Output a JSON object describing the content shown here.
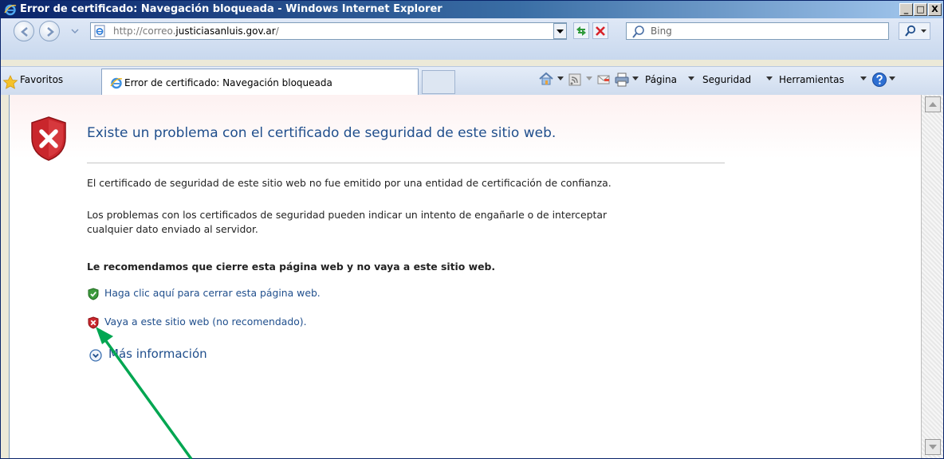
{
  "window": {
    "title": "Error de certificado: Navegación bloqueada - Windows Internet Explorer",
    "controls": {
      "minimize": "_",
      "maximize": "□",
      "close": "X"
    }
  },
  "address_bar": {
    "url_prefix": "http://correo.",
    "url_domain": "justiciasanluis.gov.ar",
    "url_suffix": "/",
    "search_placeholder": "Bing"
  },
  "favorites_bar": {
    "favorites_label": "Favoritos",
    "tab_title": "Error de certificado: Navegación bloqueada",
    "commands": {
      "page": "Página",
      "security": "Seguridad",
      "tools": "Herramientas"
    }
  },
  "content": {
    "heading": "Existe un problema con el certificado de seguridad de este sitio web.",
    "para1": "El certificado de seguridad de este sitio web no fue emitido por una entidad de certificación de confianza.",
    "para2_line1": "Los problemas con los certificados de seguridad pueden indicar un intento de engañarle o de interceptar",
    "para2_line2": "cualquier dato enviado al servidor.",
    "recommendation": "Le recomendamos que cierre esta página web y no vaya a este sitio web.",
    "close_link": "Haga clic aquí para cerrar esta página web.",
    "continue_link": "Vaya a este sitio web (no recomendado).",
    "more_info": "Más información"
  },
  "colors": {
    "link_blue": "#1f4e8c",
    "annotation_arrow": "#00a651",
    "titlebar": "#0a246a"
  },
  "icons": [
    "ie-logo-icon",
    "back-icon",
    "forward-icon",
    "page-icon",
    "refresh-icon",
    "stop-icon",
    "search-icon",
    "favorites-star-icon",
    "home-icon",
    "feeds-icon",
    "mail-icon",
    "print-icon",
    "help-icon",
    "shield-error-icon",
    "shield-ok-icon",
    "shield-x-icon",
    "expand-icon"
  ]
}
